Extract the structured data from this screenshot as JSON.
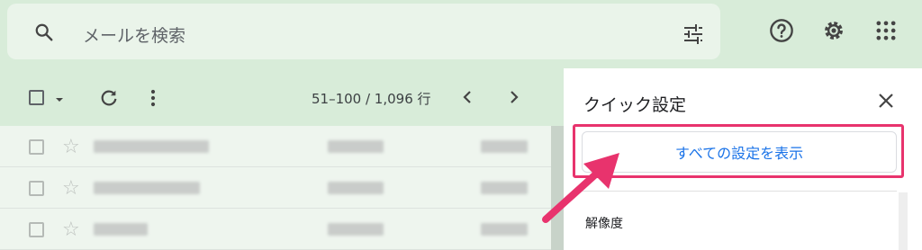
{
  "search": {
    "placeholder": "メールを検索"
  },
  "toolbar": {
    "pagination": "51–100 / 1,096 行"
  },
  "quick_settings": {
    "title": "クイック設定",
    "see_all_button": "すべての設定を表示",
    "section_density": "解像度"
  },
  "colors": {
    "accent": "#1a73e8",
    "highlight": "#e8336d",
    "background": "#d8ecd9"
  }
}
